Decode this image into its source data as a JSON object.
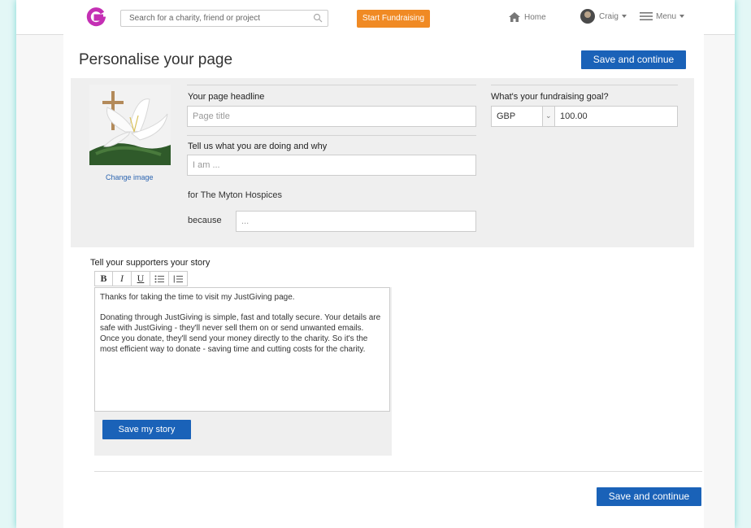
{
  "topbar": {
    "search_placeholder": "Search for a charity, friend or project",
    "start_fundraising": "Start Fundraising",
    "home": "Home",
    "user": "Craig",
    "menu": "Menu"
  },
  "page": {
    "title": "Personalise your page",
    "save_continue": "Save and continue",
    "change_image": "Change image",
    "headline_label": "Your page headline",
    "headline_placeholder": "Page title",
    "goal_label": "What's your fundraising goal?",
    "currency": "GBP",
    "goal_value": "100.00",
    "tell_label": "Tell us what you are doing and why",
    "tell_placeholder": "I am ...",
    "charity_text": "for The Myton Hospices",
    "because_label": "because",
    "because_placeholder": "..."
  },
  "story": {
    "label": "Tell your supporters your story",
    "toolbar": {
      "bold": "B",
      "italic": "I",
      "underline": "U"
    },
    "paragraph1": "Thanks for taking the time to visit my JustGiving page.",
    "paragraph2": "Donating through JustGiving is simple, fast and totally secure. Your details are safe with JustGiving - they'll never sell them on or send unwanted emails. Once you donate, they'll send your money directly to the charity. So it's the most efficient way to donate - saving time and cutting costs for the charity.",
    "save_story": "Save my story"
  },
  "colors": {
    "brand_blue": "#1a62b8",
    "orange": "#f08a24",
    "logo_magenta": "#c42fb4"
  },
  "icons": [
    "justgiving-logo-icon",
    "search-icon",
    "home-icon",
    "avatar",
    "hamburger-menu-icon",
    "bullet-list-icon",
    "numbered-list-icon",
    "chevron-down-icon"
  ]
}
